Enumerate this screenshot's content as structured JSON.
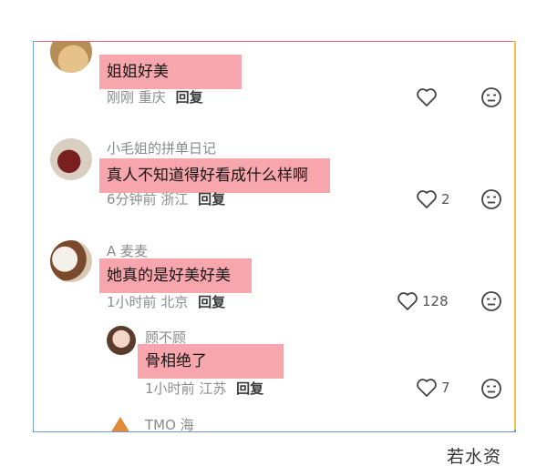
{
  "comments": [
    {
      "username": "",
      "text": "姐姐好美",
      "time": "刚刚",
      "location": "重庆",
      "reply_label": "回复",
      "likes": ""
    },
    {
      "username": "小毛姐的拼单日记",
      "text": "真人不知道得好看成什么样啊",
      "time": "6分钟前",
      "location": "浙江",
      "reply_label": "回复",
      "likes": "2"
    },
    {
      "username": "A 麦麦",
      "text": "她真的是好美好美",
      "time": "1小时前",
      "location": "北京",
      "reply_label": "回复",
      "likes": "128"
    },
    {
      "username": "顾不顾",
      "text": "骨相绝了",
      "time": "1小时前",
      "location": "江苏",
      "reply_label": "回复",
      "likes": "7"
    },
    {
      "username": "TMO 海"
    }
  ],
  "watermark": "若水资"
}
